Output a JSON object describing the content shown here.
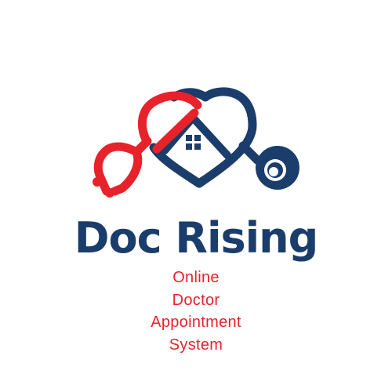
{
  "brand": {
    "name": "Doc Rising",
    "tagline_lines": [
      "Online",
      "Doctor",
      "Appointment",
      "System"
    ]
  },
  "colors": {
    "navy": "#1b3d6b",
    "red": "#e8222a",
    "background": "#ffffff"
  },
  "icons": {
    "logo": "heart-house-stethoscope-icon"
  }
}
